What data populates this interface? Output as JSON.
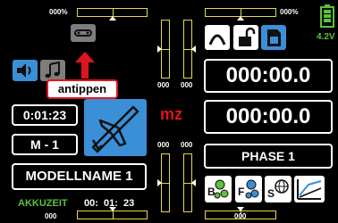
{
  "trims": {
    "top_left_pct": "000%",
    "top_right_pct": "000%",
    "left_mid_a": "000",
    "left_mid_b": "000",
    "left_lower_a": "000",
    "left_lower_b": "000",
    "bottom_left": "000",
    "bottom_right": "000"
  },
  "battery": {
    "voltage": "4.2V",
    "level": 0.9
  },
  "callout": {
    "label": "antippen"
  },
  "left_panel": {
    "timer": "0:01:23",
    "model_memory": "M - 1"
  },
  "center": {
    "mz_logo": "mz"
  },
  "right_panel": {
    "timer_top": "000:00.0",
    "timer_bottom": "000:00.0",
    "phase": "PHASE 1"
  },
  "bottom": {
    "model_name": "MODELLNAME  1",
    "akkuzeit_label": "AKKUZEIT",
    "akkuzeit_value": "00:  01:  23"
  },
  "colors": {
    "trim_yellow": "#e8d84a",
    "accent_blue": "#3a8fd6",
    "green": "#5cc23a",
    "red_mz": "#e0141e",
    "gray_button": "#7d7d7d"
  },
  "icons": [
    "servo-icon",
    "speaker-icon",
    "music-note-icon",
    "key-lock-icon",
    "sd-card-icon",
    "airplane-icon",
    "battery-icon",
    "gear-tree-icon",
    "gear-icon",
    "s-globe-icon",
    "arrows-diagram-icon"
  ]
}
